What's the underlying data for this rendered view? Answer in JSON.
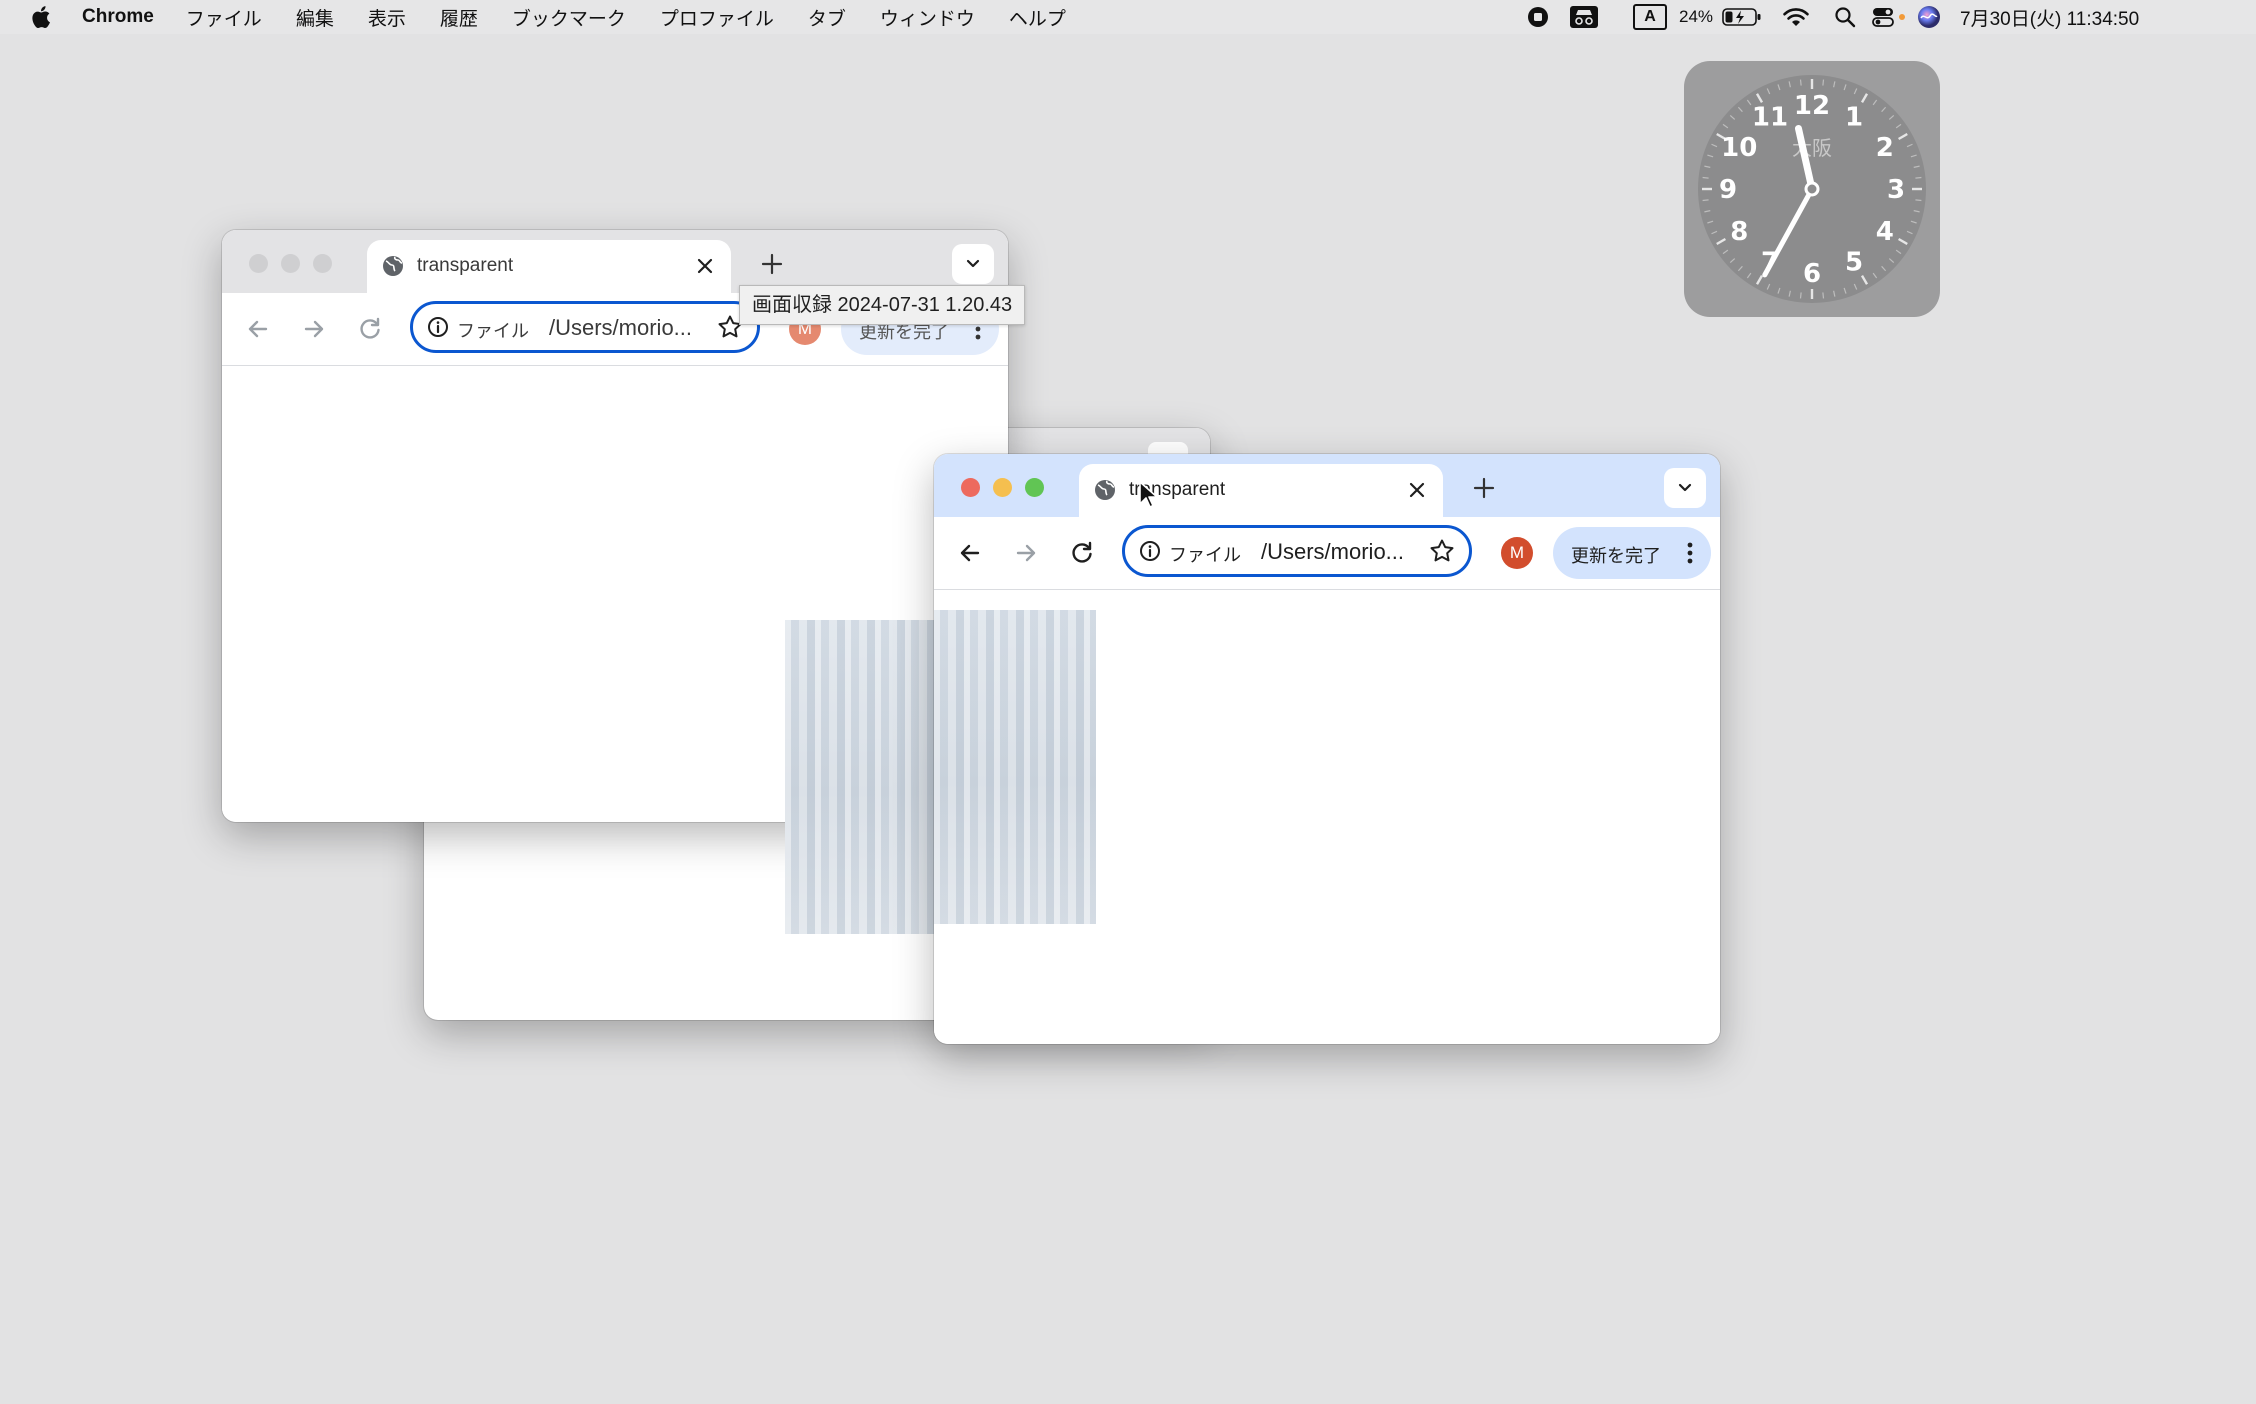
{
  "menubar": {
    "app_name": "Chrome",
    "menus": [
      "ファイル",
      "編集",
      "表示",
      "履歴",
      "ブックマーク",
      "プロファイル",
      "タブ",
      "ウィンドウ",
      "ヘルプ"
    ],
    "status": {
      "input_mode": "A",
      "battery": "24%",
      "datetime": "7月30日(火) 11:34:50"
    }
  },
  "clock_widget": {
    "city": "大阪",
    "numerals": [
      "12",
      "1",
      "2",
      "3",
      "4",
      "5",
      "6",
      "7",
      "8",
      "9",
      "10",
      "11"
    ],
    "hour_hand": 11.58,
    "minute_hand": 34.8
  },
  "back_window": {
    "tab_title": "transparent",
    "chip": "ファイル",
    "url": "/Users/morio...",
    "avatar": "M",
    "update_label": "更新を完了"
  },
  "tooltip": {
    "text": "画面収録 2024-07-31 1.20.43"
  },
  "front_window": {
    "tab_title": "transparent",
    "chip": "ファイル",
    "url": "/Users/morio...",
    "avatar": "M",
    "update_label": "更新を完了"
  },
  "colors": {
    "accent_blue": "#0b57d0",
    "active_tabstrip": "#d3e3fd",
    "avatar": "#d24d2d",
    "close_red": "#ed6a5e",
    "minimize_yellow": "#f5bf4f",
    "zoom_green": "#61c554"
  }
}
